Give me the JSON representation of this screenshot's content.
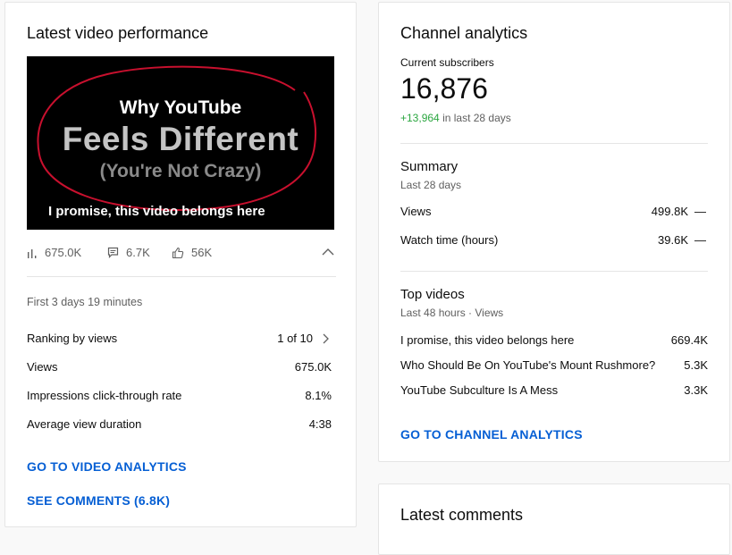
{
  "latest_video": {
    "card_title": "Latest video performance",
    "thumbnail": {
      "line1": "Why YouTube",
      "line2": "Feels Different",
      "line3": "(You're Not Crazy)",
      "caption": "I promise, this video belongs here"
    },
    "stats": {
      "views": "675.0K",
      "comments": "6.7K",
      "likes": "56K"
    },
    "period": "First 3 days 19 minutes",
    "rows": [
      {
        "label": "Ranking by views",
        "value": "1 of 10"
      },
      {
        "label": "Views",
        "value": "675.0K"
      },
      {
        "label": "Impressions click-through rate",
        "value": "8.1%"
      },
      {
        "label": "Average view duration",
        "value": "4:38"
      }
    ],
    "link_analytics": "GO TO VIDEO ANALYTICS",
    "link_comments": "SEE COMMENTS (6.8K)"
  },
  "channel": {
    "card_title": "Channel analytics",
    "subs_label": "Current subscribers",
    "subs_value": "16,876",
    "subs_delta": "+13,964",
    "subs_delta_suffix": "in last 28 days",
    "summary": {
      "title": "Summary",
      "subtitle": "Last 28 days",
      "rows": [
        {
          "label": "Views",
          "value": "499.8K",
          "trend": "—"
        },
        {
          "label": "Watch time (hours)",
          "value": "39.6K",
          "trend": "—"
        }
      ]
    },
    "top_videos": {
      "title": "Top videos",
      "subtitle": "Last 48 hours · Views",
      "rows": [
        {
          "label": "I promise, this video belongs here",
          "value": "669.4K"
        },
        {
          "label": "Who Should Be On YouTube's Mount Rushmore?",
          "value": "5.3K"
        },
        {
          "label": "YouTube Subculture Is A Mess",
          "value": "3.3K"
        }
      ]
    },
    "link": "GO TO CHANNEL ANALYTICS"
  },
  "comments": {
    "card_title": "Latest comments"
  },
  "colors": {
    "link": "#065fd4",
    "positive": "#2ba640",
    "thumb_circle": "#c8102e"
  },
  "icons": {
    "views": "bar-chart-icon",
    "comments": "comment-icon",
    "likes": "thumbs-up-icon",
    "collapse": "chevron-up-icon",
    "next": "chevron-right-icon"
  }
}
